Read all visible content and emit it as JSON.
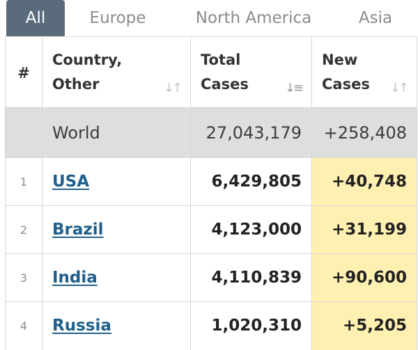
{
  "tabs": [
    {
      "label": "All",
      "active": true
    },
    {
      "label": "Europe",
      "active": false
    },
    {
      "label": "North America",
      "active": false
    },
    {
      "label": "Asia",
      "active": false
    }
  ],
  "table": {
    "headers": {
      "num": "#",
      "country": [
        "Country,",
        "Other"
      ],
      "total": [
        "Total",
        "Cases"
      ],
      "new": [
        "New",
        "Cases"
      ]
    },
    "world": {
      "label": "World",
      "total": "27,043,179",
      "new": "+258,408"
    },
    "rows": [
      {
        "rank": "1",
        "country": "USA",
        "total": "6,429,805",
        "new": "+40,748"
      },
      {
        "rank": "2",
        "country": "Brazil",
        "total": "4,123,000",
        "new": "+31,199"
      },
      {
        "rank": "3",
        "country": "India",
        "total": "4,110,839",
        "new": "+90,600"
      },
      {
        "rank": "4",
        "country": "Russia",
        "total": "1,020,310",
        "new": "+5,205"
      }
    ]
  },
  "colors": {
    "active_tab_bg": "#5a6b7c",
    "new_cases_highlight": "#fff0b2",
    "world_row_bg": "#dedede",
    "link": "#1f5f8b"
  },
  "icons": {
    "sort_default": "sort-icon",
    "sort_active": "sort-descending-icon"
  }
}
